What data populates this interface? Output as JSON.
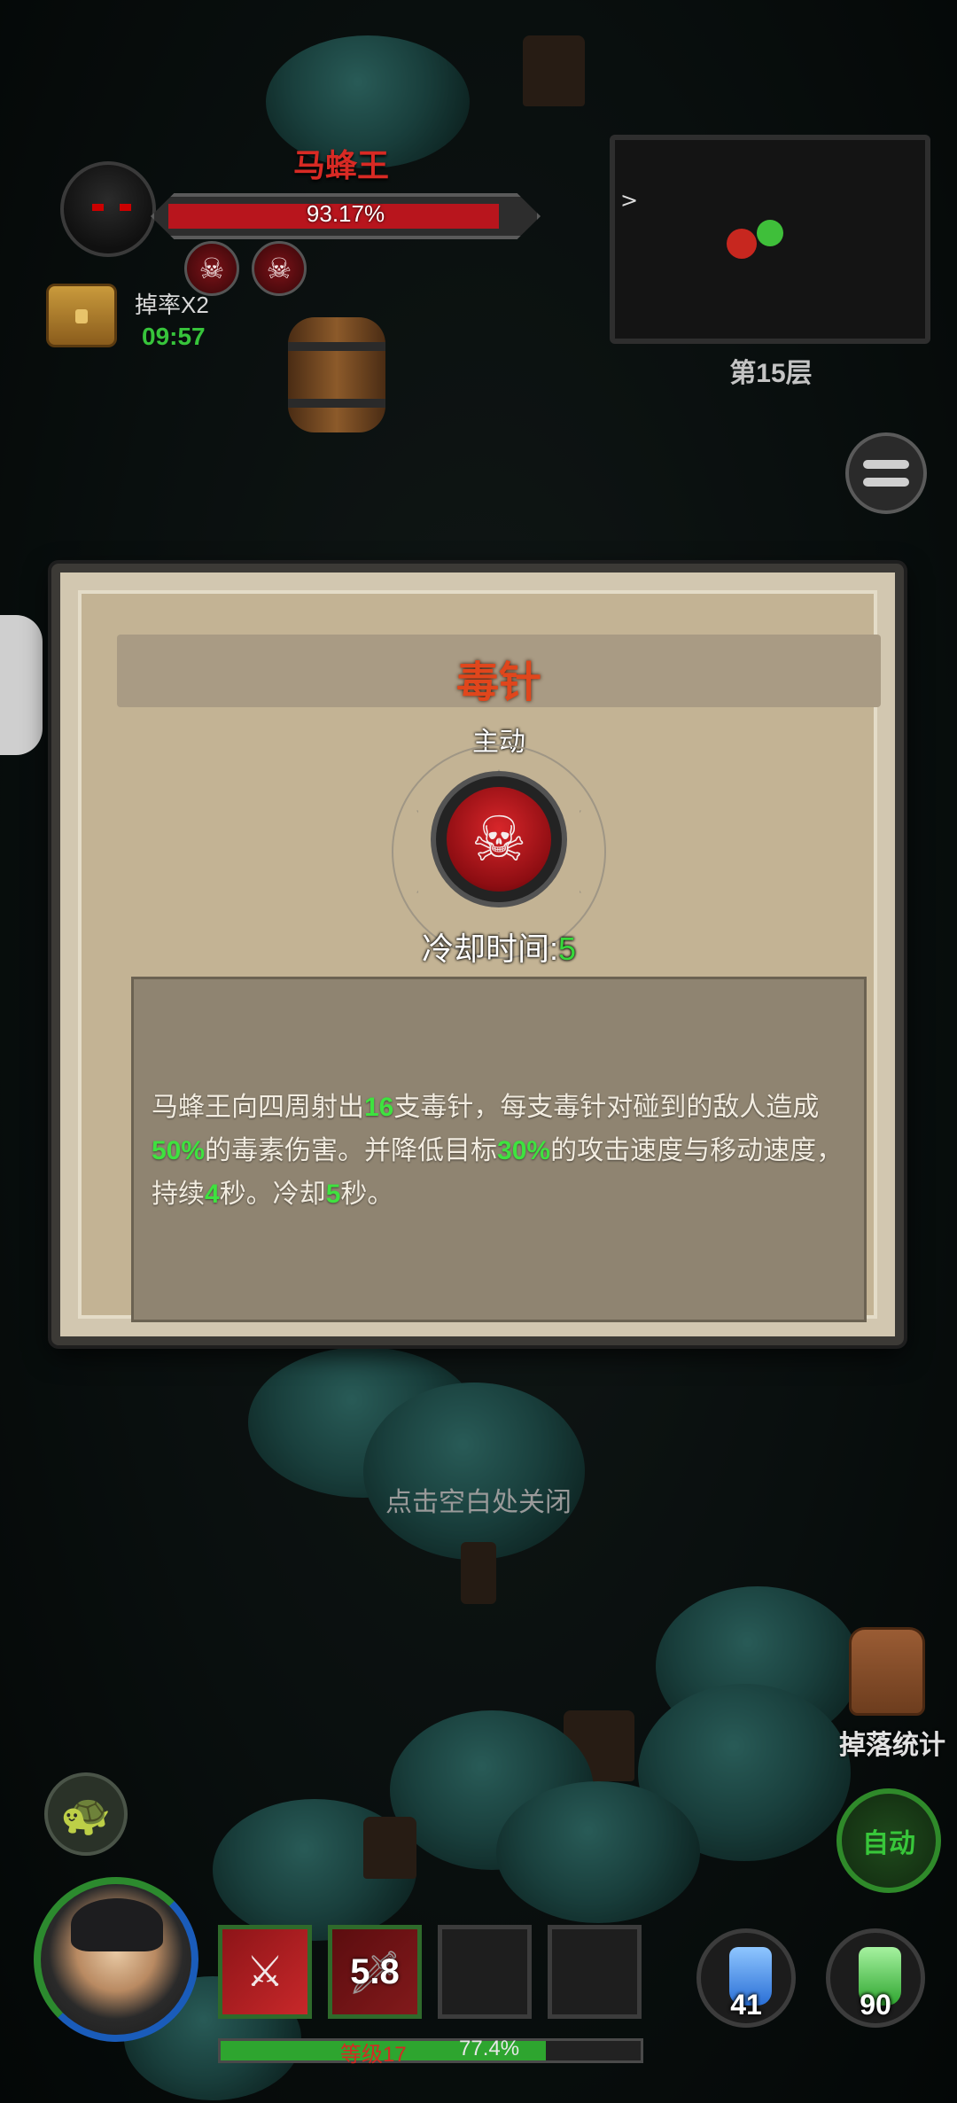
{
  "boss": {
    "name": "马蜂王",
    "hp_percent_text": "93.17%",
    "hp_fraction": 0.9317
  },
  "drop_buff": {
    "label": "掉率X2",
    "timer": "09:57"
  },
  "minimap": {
    "floor_label": "第15层"
  },
  "skill_modal": {
    "title": "毒针",
    "type": "主动",
    "cooldown_label": "冷却时间:",
    "cooldown_value": "5",
    "description": {
      "p1": "马蜂王向四周射出",
      "n1": "16",
      "p2": "支毒针，每支毒针对碰到的敌人造成",
      "n2": "50%",
      "p3": "的毒素伤害。并降低目标",
      "n3": "30%",
      "p4": "的攻击速度与移动速度，持续",
      "n4": "4",
      "p5": "秒。冷却",
      "n5": "5",
      "p6": "秒。"
    },
    "close_hint": "点击空白处关闭"
  },
  "hud": {
    "drop_stats_label": "掉落统计",
    "auto_label": "自动",
    "skill_slot_cooldown": "5.8",
    "level_text": "等级17",
    "xp_percent_text": "77.4%",
    "xp_fraction": 0.774,
    "potion_blue_count": "41",
    "potion_green_count": "90"
  },
  "colors": {
    "boss_name": "#d82a24",
    "highlight_green": "#3ee23f",
    "title_orange": "#e0461c"
  }
}
